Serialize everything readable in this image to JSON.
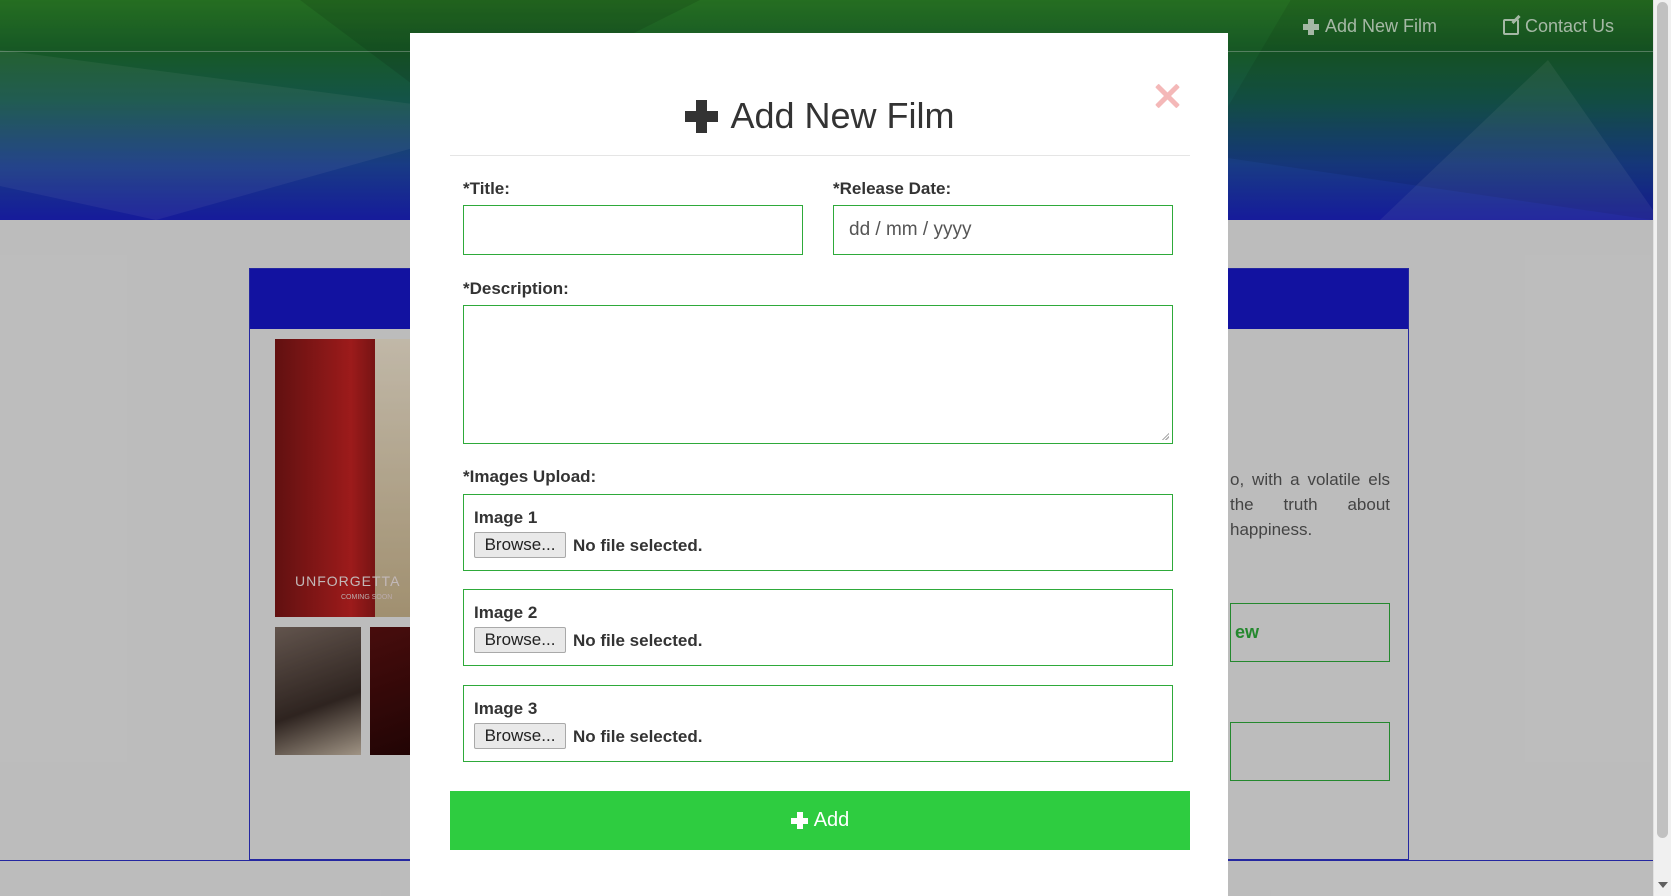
{
  "nav": {
    "add_new_film": "Add New Film",
    "contact_us": "Contact Us"
  },
  "background": {
    "poster_title": "UNFORGETTA",
    "poster_subtitle": "COMING SOON",
    "description_fragment": "o, with a volatile els the truth about happiness.",
    "review_button_fragment": "ew"
  },
  "modal": {
    "title": "Add New Film",
    "title_label": "*Title:",
    "title_value": "",
    "release_label": "*Release Date:",
    "release_placeholder": "dd / mm / yyyy",
    "description_label": "*Description:",
    "description_value": "",
    "images_label": "*Images Upload:",
    "uploads": [
      {
        "label": "Image 1",
        "button": "Browse...",
        "status": "No file selected."
      },
      {
        "label": "Image 2",
        "button": "Browse...",
        "status": "No file selected."
      },
      {
        "label": "Image 3",
        "button": "Browse...",
        "status": "No file selected."
      }
    ],
    "add_button": "Add"
  },
  "colors": {
    "accent_green": "#2ecc40",
    "field_border": "#2eaa3a",
    "close_icon": "#f4b8b8",
    "brand_blue": "#1717c8"
  },
  "icons": {
    "add": "plus-icon",
    "contact": "edit-icon",
    "close": "close-icon"
  }
}
